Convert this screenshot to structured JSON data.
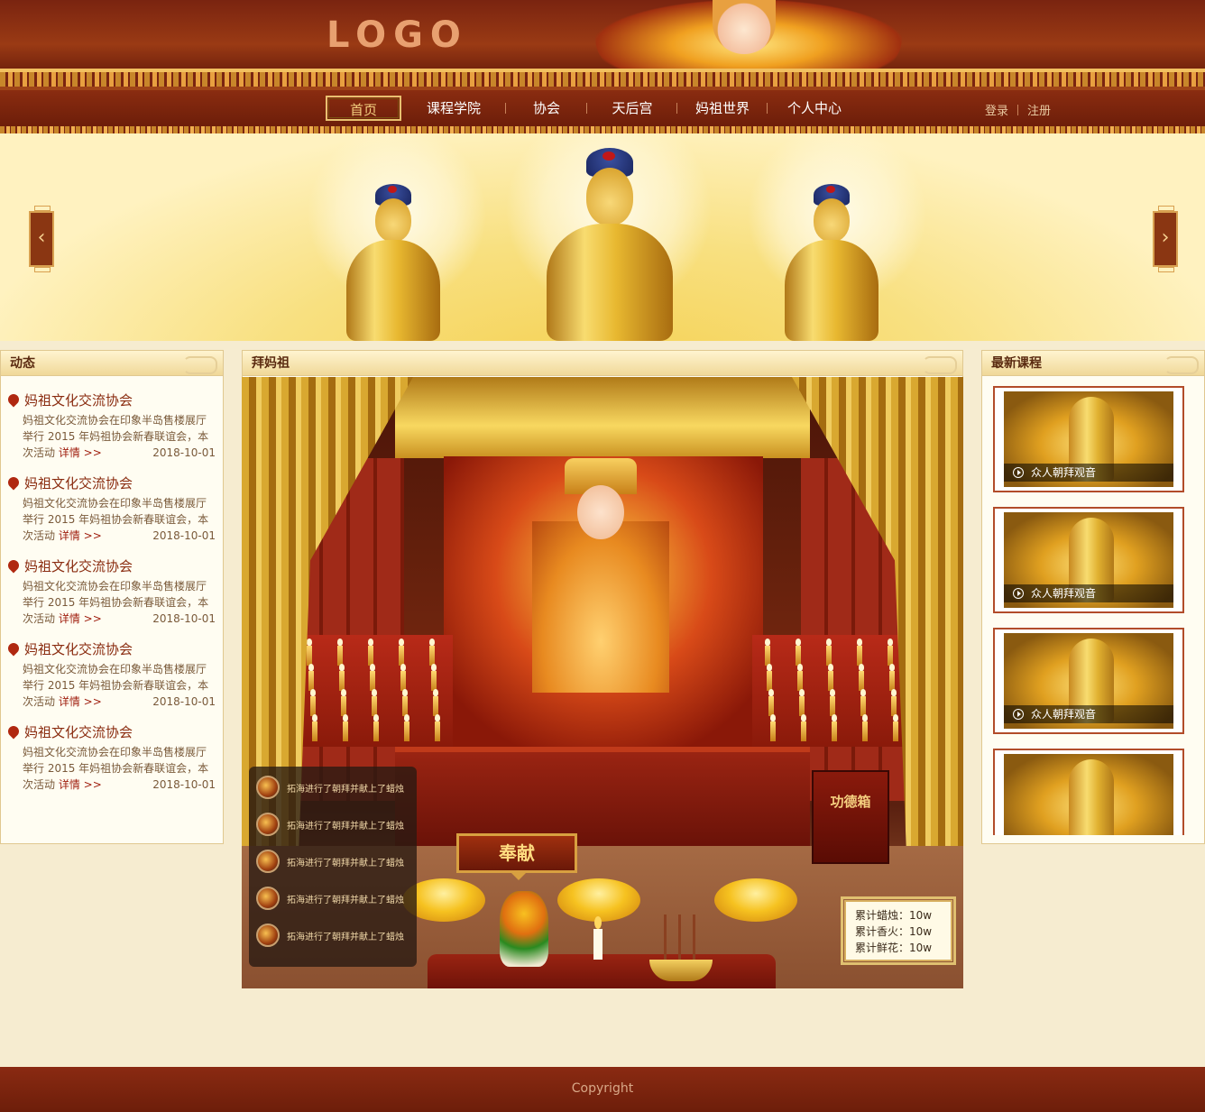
{
  "header": {
    "logo_text": "LOGO"
  },
  "nav": {
    "items": [
      "首页",
      "课程学院",
      "协会",
      "天后宫",
      "妈祖世界",
      "个人中心"
    ],
    "active_index": 0,
    "login_label": "登录",
    "register_label": "注册"
  },
  "banner": {
    "prev_icon": "chevron-left-icon",
    "next_icon": "chevron-right-icon"
  },
  "news_panel": {
    "title": "动态",
    "items": [
      {
        "title": "妈祖文化交流协会",
        "desc": "妈祖文化交流协会在印象半岛售楼展厅举行 2015 年妈祖协会新春联谊会，本次活动",
        "more": "详情 >>",
        "date": "2018-10-01"
      },
      {
        "title": "妈祖文化交流协会",
        "desc": "妈祖文化交流协会在印象半岛售楼展厅举行 2015 年妈祖协会新春联谊会，本次活动",
        "more": "详情 >>",
        "date": "2018-10-01"
      },
      {
        "title": "妈祖文化交流协会",
        "desc": "妈祖文化交流协会在印象半岛售楼展厅举行 2015 年妈祖协会新春联谊会，本次活动",
        "more": "详情 >>",
        "date": "2018-10-01"
      },
      {
        "title": "妈祖文化交流协会",
        "desc": "妈祖文化交流协会在印象半岛售楼展厅举行 2015 年妈祖协会新春联谊会，本次活动",
        "more": "详情 >>",
        "date": "2018-10-01"
      },
      {
        "title": "妈祖文化交流协会",
        "desc": "妈祖文化交流协会在印象半岛售楼展厅举行 2015 年妈祖协会新春联谊会，本次活动",
        "more": "详情 >>",
        "date": "2018-10-01"
      }
    ]
  },
  "worship_panel": {
    "title": "拜妈祖",
    "offer_button": "奉献",
    "merit_box_label": "功德箱",
    "activity_feed": [
      "拓海进行了朝拜并献上了蜡烛",
      "拓海进行了朝拜并献上了蜡烛",
      "拓海进行了朝拜并献上了蜡烛",
      "拓海进行了朝拜并献上了蜡烛",
      "拓海进行了朝拜并献上了蜡烛"
    ],
    "stats": {
      "candles": "累计蜡烛：10w",
      "incense": "累计香火：10w",
      "flowers": "累计鲜花：10w"
    }
  },
  "courses_panel": {
    "title": "最新课程",
    "items": [
      {
        "caption": "众人朝拜观音"
      },
      {
        "caption": "众人朝拜观音"
      },
      {
        "caption": "众人朝拜观音"
      },
      {
        "caption": ""
      }
    ]
  },
  "footer": {
    "text": "Copyright"
  }
}
